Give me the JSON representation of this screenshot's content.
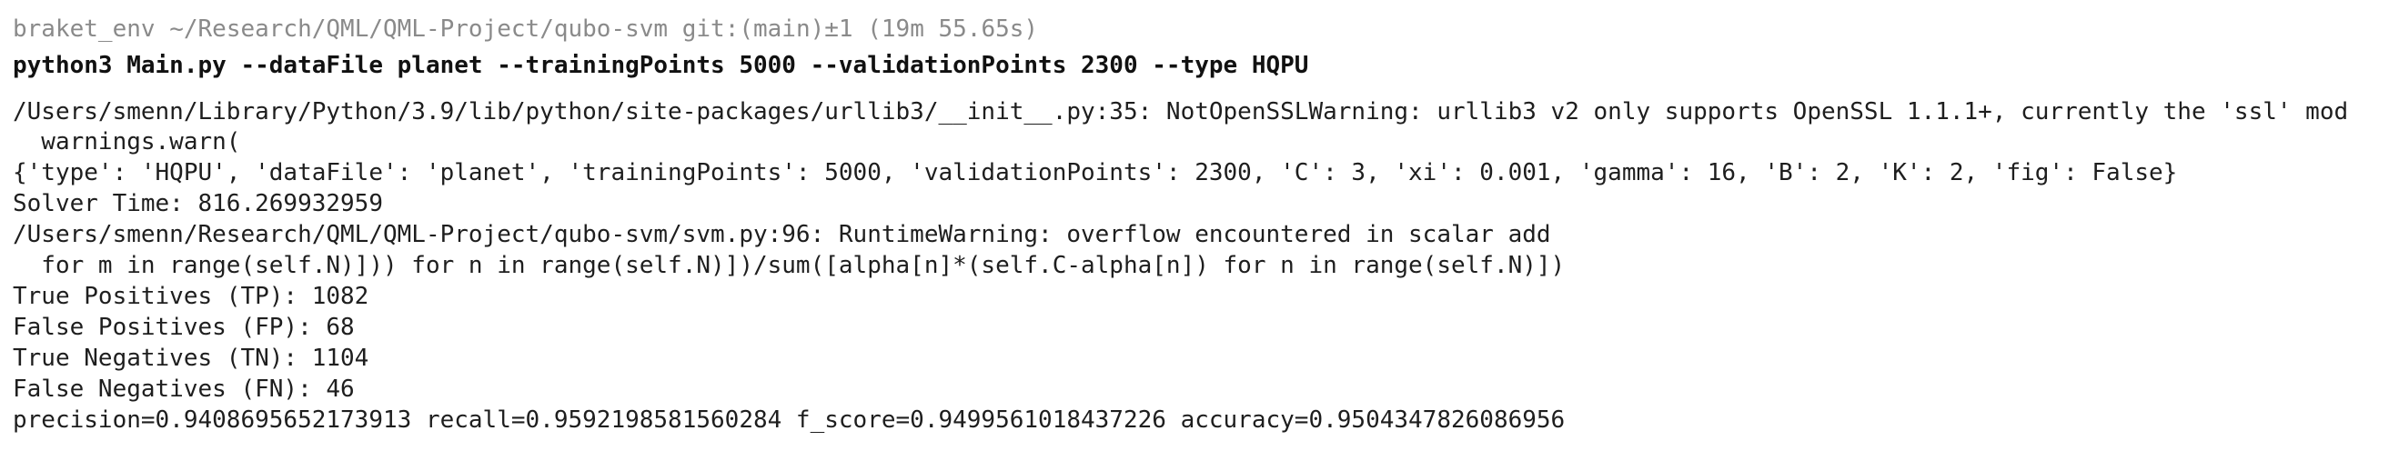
{
  "prompt": {
    "env": "braket_env",
    "path": "~/Research/QML/QML-Project/qubo-svm",
    "git": "git:(main)±1",
    "duration": "(19m 55.65s)"
  },
  "command": "python3 Main.py --dataFile planet --trainingPoints 5000 --validationPoints 2300 --type HQPU",
  "output": [
    "/Users/smenn/Library/Python/3.9/lib/python/site-packages/urllib3/__init__.py:35: NotOpenSSLWarning: urllib3 v2 only supports OpenSSL 1.1.1+, currently the 'ssl' mod",
    "  warnings.warn(",
    "{'type': 'HQPU', 'dataFile': 'planet', 'trainingPoints': 5000, 'validationPoints': 2300, 'C': 3, 'xi': 0.001, 'gamma': 16, 'B': 2, 'K': 2, 'fig': False}",
    "Solver Time: 816.269932959",
    "/Users/smenn/Research/QML/QML-Project/qubo-svm/svm.py:96: RuntimeWarning: overflow encountered in scalar add",
    "  for m in range(self.N)])) for n in range(self.N)])/sum([alpha[n]*(self.C-alpha[n]) for n in range(self.N)])",
    "True Positives (TP): 1082",
    "False Positives (FP): 68",
    "True Negatives (TN): 1104",
    "False Negatives (FN): 46",
    "precision=0.9408695652173913 recall=0.9592198581560284 f_score=0.9499561018437226 accuracy=0.9504347826086956"
  ]
}
